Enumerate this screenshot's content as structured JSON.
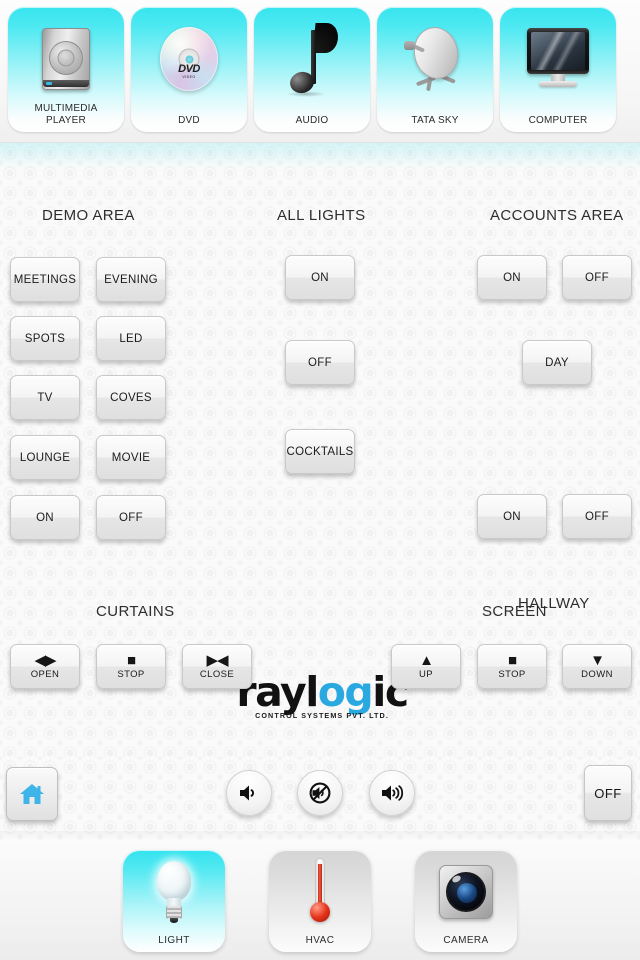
{
  "top_bar": {
    "devices": [
      {
        "label": "MULTIMEDIA\nPLAYER",
        "icon": "hard-drive-icon"
      },
      {
        "label": "DVD",
        "icon": "dvd-disc-icon"
      },
      {
        "label": "AUDIO",
        "icon": "music-note-icon"
      },
      {
        "label": "TATA SKY",
        "icon": "satellite-dish-icon"
      },
      {
        "label": "COMPUTER",
        "icon": "monitor-icon"
      }
    ]
  },
  "main": {
    "demo_area": {
      "title": "DEMO AREA",
      "buttons": [
        "MEETINGS",
        "EVENING",
        "SPOTS",
        "LED",
        "TV",
        "COVES",
        "LOUNGE",
        "MOVIE",
        "ON",
        "OFF"
      ]
    },
    "all_lights": {
      "title": "ALL LIGHTS",
      "buttons": [
        "ON",
        "OFF",
        "COCKTAILS"
      ]
    },
    "accounts_area": {
      "title": "ACCOUNTS AREA",
      "buttons": [
        "ON",
        "OFF",
        "DAY"
      ]
    },
    "hallway": {
      "title": "HALLWAY",
      "buttons": [
        "ON",
        "OFF"
      ]
    },
    "curtains": {
      "title": "CURTAINS",
      "buttons": [
        {
          "label": "OPEN",
          "glyph": "◀▶",
          "icon": "curtain-open-icon"
        },
        {
          "label": "STOP",
          "glyph": "■",
          "icon": "stop-square-icon"
        },
        {
          "label": "CLOSE",
          "glyph": "▶◀",
          "icon": "curtain-close-icon"
        }
      ]
    },
    "screen": {
      "title": "SCREEN",
      "buttons": [
        {
          "label": "UP",
          "glyph": "▲",
          "icon": "arrow-up-icon"
        },
        {
          "label": "STOP",
          "glyph": "■",
          "icon": "stop-square-icon"
        },
        {
          "label": "DOWN",
          "glyph": "▼",
          "icon": "arrow-down-icon"
        }
      ]
    },
    "logo": {
      "word_start": "rayl",
      "word_highlight": "og",
      "word_end": "ic",
      "tagline": "CONTROL SYSTEMS PVT. LTD.",
      "highlight_color": "#29a9e0"
    }
  },
  "toolbar": {
    "home": {
      "icon": "home-icon",
      "color": "#3fb4e8"
    },
    "volume_down": {
      "icon": "volume-down-icon"
    },
    "mute": {
      "icon": "volume-mute-icon"
    },
    "volume_up": {
      "icon": "volume-up-icon"
    },
    "power_off_label": "OFF"
  },
  "bottom_nav": {
    "items": [
      {
        "label": "LIGHT",
        "icon": "light-bulb-icon",
        "active": true
      },
      {
        "label": "HVAC",
        "icon": "thermometer-icon",
        "active": false
      },
      {
        "label": "CAMERA",
        "icon": "camera-lens-icon",
        "active": false
      }
    ]
  }
}
